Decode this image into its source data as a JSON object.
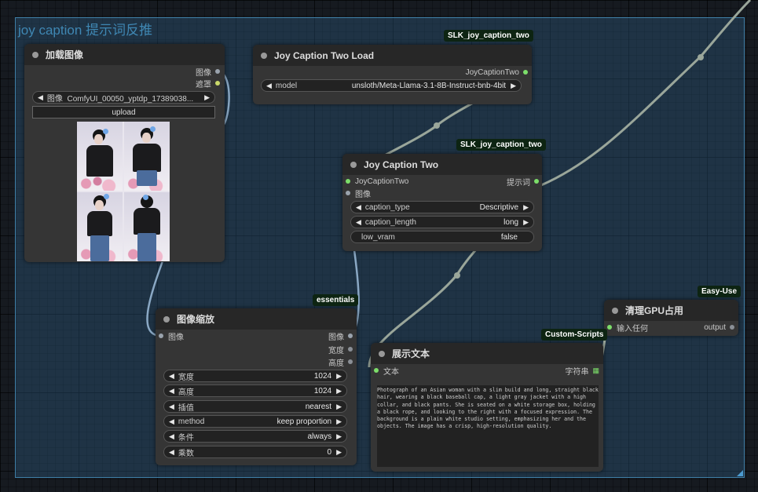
{
  "group": {
    "title": "joy caption 提示词反推"
  },
  "load_image": {
    "title": "加载图像",
    "outputs": [
      "图像",
      "遮罩"
    ],
    "image_label": "图像",
    "image_value": "ComfyUI_00050_yptdp_17389038...",
    "upload_label": "upload"
  },
  "joy_load": {
    "badge": "SLK_joy_caption_two",
    "title": "Joy Caption Two Load",
    "output": "JoyCaptionTwo",
    "model_label": "model",
    "model_value": "unsloth/Meta-Llama-3.1-8B-Instruct-bnb-4bit"
  },
  "joy_caption": {
    "badge": "SLK_joy_caption_two",
    "title": "Joy Caption Two",
    "inputs": [
      "JoyCaptionTwo",
      "图像"
    ],
    "output": "提示词",
    "widgets": [
      {
        "label": "caption_type",
        "value": "Descriptive"
      },
      {
        "label": "caption_length",
        "value": "long"
      },
      {
        "label": "low_vram",
        "value": "false"
      }
    ]
  },
  "image_scale": {
    "badge": "essentials",
    "title": "图像缩放",
    "input": "图像",
    "outputs": [
      "图像",
      "宽度",
      "高度"
    ],
    "widgets": [
      {
        "label": "宽度",
        "value": "1024"
      },
      {
        "label": "高度",
        "value": "1024"
      },
      {
        "label": "插值",
        "value": "nearest"
      },
      {
        "label": "method",
        "value": "keep proportion"
      },
      {
        "label": "条件",
        "value": "always"
      },
      {
        "label": "乘数",
        "value": "0"
      }
    ]
  },
  "show_text": {
    "badge": "Custom-Scripts",
    "title": "展示文本",
    "input": "文本",
    "output": "字符串",
    "text": "Photograph of an Asian woman with a slim build and long, straight black hair, wearing a black baseball cap, a light gray jacket with a high collar, and black pants. She is seated on a white storage box, holding a black rope, and looking to the right with a focused expression. The background is a plain white studio setting, emphasizing her and the objects. The image has a crisp, high-resolution quality."
  },
  "clean_gpu": {
    "badge": "Easy-Use",
    "title": "清理GPU占用",
    "input": "输入任何",
    "output": "output"
  },
  "colors": {
    "wire": "#9aa69a",
    "wire_image": "#8aa8c4",
    "slot_green": "#7cde6a",
    "badge_bg": "#0d2412",
    "group_border": "#3f7fa7"
  }
}
